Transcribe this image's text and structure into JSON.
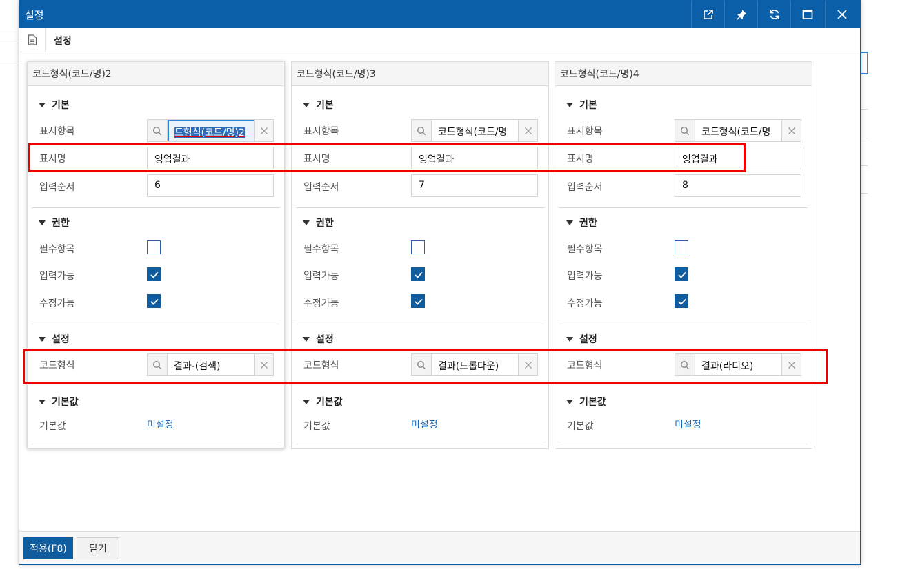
{
  "window": {
    "title": "설정"
  },
  "subbar": {
    "title": "설정"
  },
  "sections": {
    "basic": "기본",
    "permission": "권한",
    "settings": "설정",
    "default": "기본값"
  },
  "labels": {
    "display_item": "표시항목",
    "display_name": "표시명",
    "input_order": "입력순서",
    "required": "필수항목",
    "input_enabled": "입력가능",
    "edit_enabled": "수정가능",
    "code_format": "코드형식",
    "default_value": "기본값"
  },
  "panels": [
    {
      "header": "코드형식(코드/명)2",
      "display_item": "드형식(코드/명)2",
      "display_name": "영업결과",
      "input_order": "6",
      "required": false,
      "input_enabled": true,
      "edit_enabled": true,
      "code_format": "결과-(검색)",
      "default_value": "미설정"
    },
    {
      "header": "코드형식(코드/명)3",
      "display_item": "코드형식(코드/명",
      "display_name": "영업결과",
      "input_order": "7",
      "required": false,
      "input_enabled": true,
      "edit_enabled": true,
      "code_format": "결과(드롭다운)",
      "default_value": "미설정"
    },
    {
      "header": "코드형식(코드/명)4",
      "display_item": "코드형식(코드/명",
      "display_name": "영업결과",
      "input_order": "8",
      "required": false,
      "input_enabled": true,
      "edit_enabled": true,
      "code_format": "결과(라디오)",
      "default_value": "미설정"
    }
  ],
  "footer": {
    "apply_label": "적용(F8)",
    "close_label": "닫기"
  },
  "colors": {
    "titlebar": "#0b5ea8",
    "accent": "#0f5d9e",
    "highlight": "#e00000",
    "link": "#1a6bb8"
  }
}
